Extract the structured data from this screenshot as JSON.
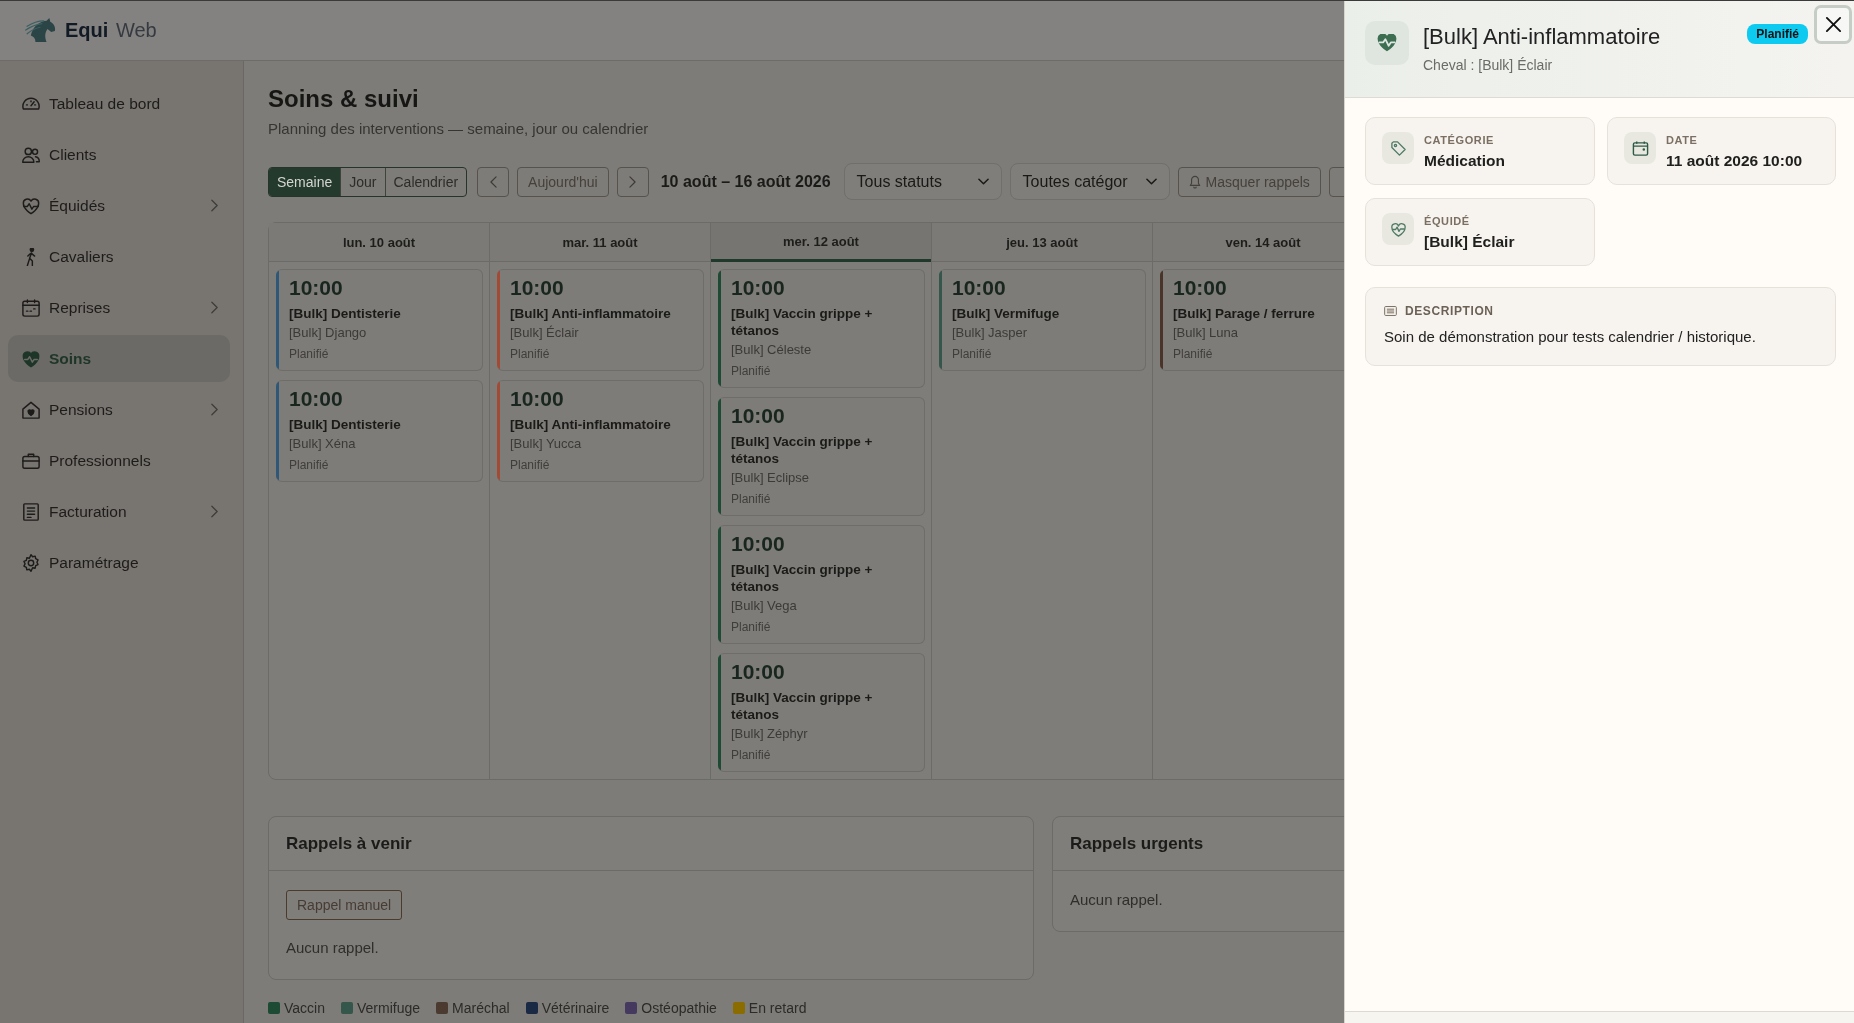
{
  "brand": "**Equi** Web",
  "sidebar": {
    "items": [
      {
        "label": "Tableau de bord",
        "selected": false,
        "has_submenu": false
      },
      {
        "label": "Clients",
        "selected": false,
        "has_submenu": false
      },
      {
        "label": "Équidés",
        "selected": false,
        "has_submenu": true
      },
      {
        "label": "Cavaliers",
        "selected": false,
        "has_submenu": false
      },
      {
        "label": "Reprises",
        "selected": false,
        "has_submenu": true
      },
      {
        "label": "Soins",
        "selected": true,
        "has_submenu": false
      },
      {
        "label": "Pensions",
        "selected": false,
        "has_submenu": true
      },
      {
        "label": "Professionnels",
        "selected": false,
        "has_submenu": false
      },
      {
        "label": "Facturation",
        "selected": false,
        "has_submenu": true
      },
      {
        "label": "Paramétrage",
        "selected": false,
        "has_submenu": false
      }
    ]
  },
  "page": {
    "title": "Soins & suivi",
    "subtitle": "Planning des interventions — semaine, jour ou calendrier"
  },
  "toolbar": {
    "views": [
      {
        "label": "Semaine",
        "selected": true
      },
      {
        "label": "Jour",
        "selected": false
      },
      {
        "label": "Calendrier",
        "selected": false
      }
    ],
    "today": "Aujourd'hui",
    "range": "10 août – 16 août 2026",
    "filters": [
      {
        "value": "Tous statuts"
      },
      {
        "value": "Toutes catégor"
      }
    ],
    "reminders_toggle": "Masquer rappels"
  },
  "calendar": {
    "days": [
      {
        "label": "lun. 10 août",
        "current": false,
        "events": [
          {
            "time": "10:00",
            "title": "[Bulk] Dentisterie",
            "horse": "[Bulk] Django",
            "status": "Planifié",
            "color": "#2f5878"
          },
          {
            "time": "10:00",
            "title": "[Bulk] Dentisterie",
            "horse": "[Bulk] Xéna",
            "status": "Planifié",
            "color": "#2f5878"
          }
        ]
      },
      {
        "label": "mar. 11 août",
        "current": false,
        "events": [
          {
            "time": "10:00",
            "title": "[Bulk] Anti-inflammatoire",
            "horse": "[Bulk] Éclair",
            "status": "Planifié",
            "color": "#a34a34"
          },
          {
            "time": "10:00",
            "title": "[Bulk] Anti-inflammatoire",
            "horse": "[Bulk] Yucca",
            "status": "Planifié",
            "color": "#a34a34"
          }
        ]
      },
      {
        "label": "mer. 12 août",
        "current": true,
        "events": [
          {
            "time": "10:00",
            "title": "[Bulk] Vaccin grippe + tétanos",
            "horse": "[Bulk] Céleste",
            "status": "Planifié",
            "color": "#1d4a33"
          },
          {
            "time": "10:00",
            "title": "[Bulk] Vaccin grippe + tétanos",
            "horse": "[Bulk] Eclipse",
            "status": "Planifié",
            "color": "#1d4a33"
          },
          {
            "time": "10:00",
            "title": "[Bulk] Vaccin grippe + tétanos",
            "horse": "[Bulk] Vega",
            "status": "Planifié",
            "color": "#1d4a33"
          },
          {
            "time": "10:00",
            "title": "[Bulk] Vaccin grippe + tétanos",
            "horse": "[Bulk] Zéphyr",
            "status": "Planifié",
            "color": "#1d4a33"
          }
        ]
      },
      {
        "label": "jeu. 13 août",
        "current": false,
        "events": [
          {
            "time": "10:00",
            "title": "[Bulk] Vermifuge",
            "horse": "[Bulk] Jasper",
            "status": "Planifié",
            "color": "#35564b"
          }
        ]
      },
      {
        "label": "ven. 14 août",
        "current": false,
        "events": [
          {
            "time": "10:00",
            "title": "[Bulk] Parage / ferrure",
            "horse": "[Bulk] Luna",
            "status": "Planifié",
            "color": "#4a3328"
          }
        ]
      }
    ]
  },
  "reminders": [
    {
      "title": "Rappels à venir",
      "action": "Rappel manuel",
      "empty": "Aucun rappel."
    },
    {
      "title": "Rappels urgents",
      "empty": "Aucun rappel."
    }
  ],
  "legend": [
    {
      "label": "Vaccin",
      "color": "#1d4a33"
    },
    {
      "label": "Vermifuge",
      "color": "#35564b"
    },
    {
      "label": "Maréchal",
      "color": "#4a3a30"
    },
    {
      "label": "Vétérinaire",
      "color": "#1a2a45"
    },
    {
      "label": "Ostéopathie",
      "color": "#45395f"
    },
    {
      "label": "En retard",
      "color": "#8a6c00"
    }
  ],
  "drawer": {
    "title": "[Bulk] Anti-inflammatoire",
    "subtitle": "Cheval : [Bulk] Éclair",
    "badge": "Planifié",
    "fields": [
      {
        "label": "CATÉGORIE",
        "value": "Médication"
      },
      {
        "label": "DATE",
        "value": "11 août 2026 10:00"
      },
      {
        "label": "ÉQUIDÉ",
        "value": "[Bulk] Éclair"
      }
    ],
    "description": {
      "label": "DESCRIPTION",
      "text": "Soin de démonstration pour tests calendrier / historique."
    }
  }
}
